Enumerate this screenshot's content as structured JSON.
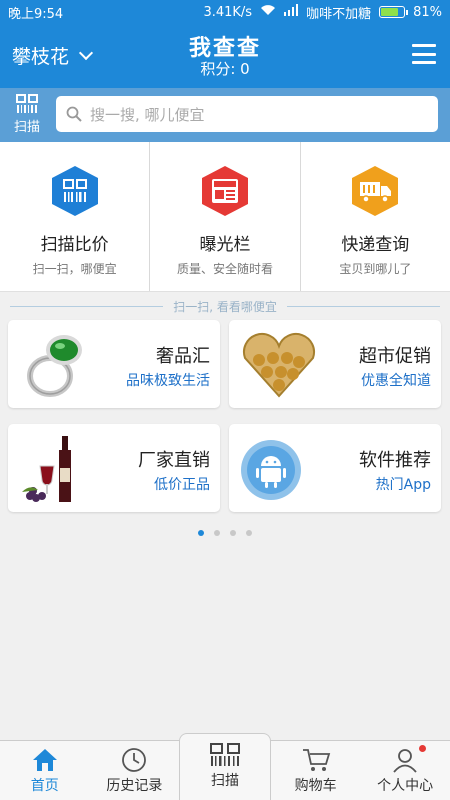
{
  "status": {
    "time": "晚上9:54",
    "speed": "3.41K/s",
    "carrier": "咖啡不加糖",
    "battery": "81%",
    "battery_level": 0.81
  },
  "header": {
    "city": "攀枝花",
    "title": "我查查",
    "score": "积分: 0"
  },
  "search": {
    "scan_label": "扫描",
    "placeholder": "搜一搜, 哪儿便宜"
  },
  "features": [
    {
      "title": "扫描比价",
      "subtitle": "扫一扫，哪便宜",
      "color": "#1e7fd6",
      "icon": "barcode-icon"
    },
    {
      "title": "曝光栏",
      "subtitle": "质量、安全随时看",
      "color": "#e53935",
      "icon": "news-icon"
    },
    {
      "title": "快递查询",
      "subtitle": "宝贝到哪儿了",
      "color": "#f0a01c",
      "icon": "truck-icon"
    }
  ],
  "divider_text": "扫一扫, 看看哪便宜",
  "cards": [
    {
      "title": "奢品汇",
      "subtitle": "品味极致生活",
      "icon": "ring-icon"
    },
    {
      "title": "超市促销",
      "subtitle": "优惠全知道",
      "icon": "chocolate-box-icon"
    },
    {
      "title": "厂家直销",
      "subtitle": "低价正品",
      "icon": "wine-icon"
    },
    {
      "title": "软件推荐",
      "subtitle": "热门App",
      "icon": "android-icon"
    }
  ],
  "pager": {
    "count": 4,
    "active": 0
  },
  "tabs": [
    {
      "label": "首页",
      "icon": "home-icon"
    },
    {
      "label": "历史记录",
      "icon": "clock-icon"
    },
    {
      "label": "扫描",
      "icon": "barcode-icon"
    },
    {
      "label": "购物车",
      "icon": "cart-icon"
    },
    {
      "label": "个人中心",
      "icon": "person-icon"
    }
  ],
  "colors": {
    "primary": "#1e88d8",
    "accent_text": "#1e70c8",
    "notification": "#e53935"
  }
}
